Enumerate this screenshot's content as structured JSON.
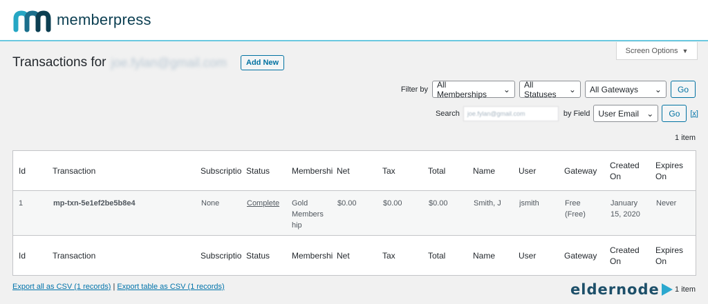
{
  "brand": {
    "name": "memberpress",
    "colors": {
      "teal": "#26a7c4",
      "navy": "#0c3f52"
    }
  },
  "screen_options": {
    "label": "Screen Options"
  },
  "page": {
    "title_prefix": "Transactions for",
    "title_email": "joe.fylan@gmail.com",
    "add_new": "Add New"
  },
  "filters": {
    "label": "Filter by",
    "memberships": "All Memberships",
    "statuses": "All Statuses",
    "gateways": "All Gateways",
    "go": "Go"
  },
  "search": {
    "label": "Search",
    "value": "joe.fylan@gmail.com",
    "by_field_label": "by Field",
    "field": "User Email",
    "go": "Go",
    "clear": "[x]"
  },
  "item_count": "1 item",
  "table": {
    "headers": [
      "Id",
      "Transaction",
      "Subscriptio",
      "Status",
      "Membershi",
      "Net",
      "Tax",
      "Total",
      "Name",
      "User",
      "Gateway",
      "Created On",
      "Expires On"
    ],
    "rows": [
      {
        "id": "1",
        "transaction": "mp-txn-5e1ef2be5b8e4",
        "subscription": "None",
        "status": "Complete",
        "membership": "Gold Members hip",
        "net": "$0.00",
        "tax": "$0.00",
        "total": "$0.00",
        "name": "Smith, J",
        "user": "jsmith",
        "gateway": "Free (Free)",
        "created": "January 15, 2020",
        "expires": "Never"
      }
    ]
  },
  "export": {
    "all": "Export all as CSV (1 records)",
    "separator": "|",
    "table": "Export table as CSV (1 records)"
  },
  "watermark": {
    "text": "eldernode"
  }
}
